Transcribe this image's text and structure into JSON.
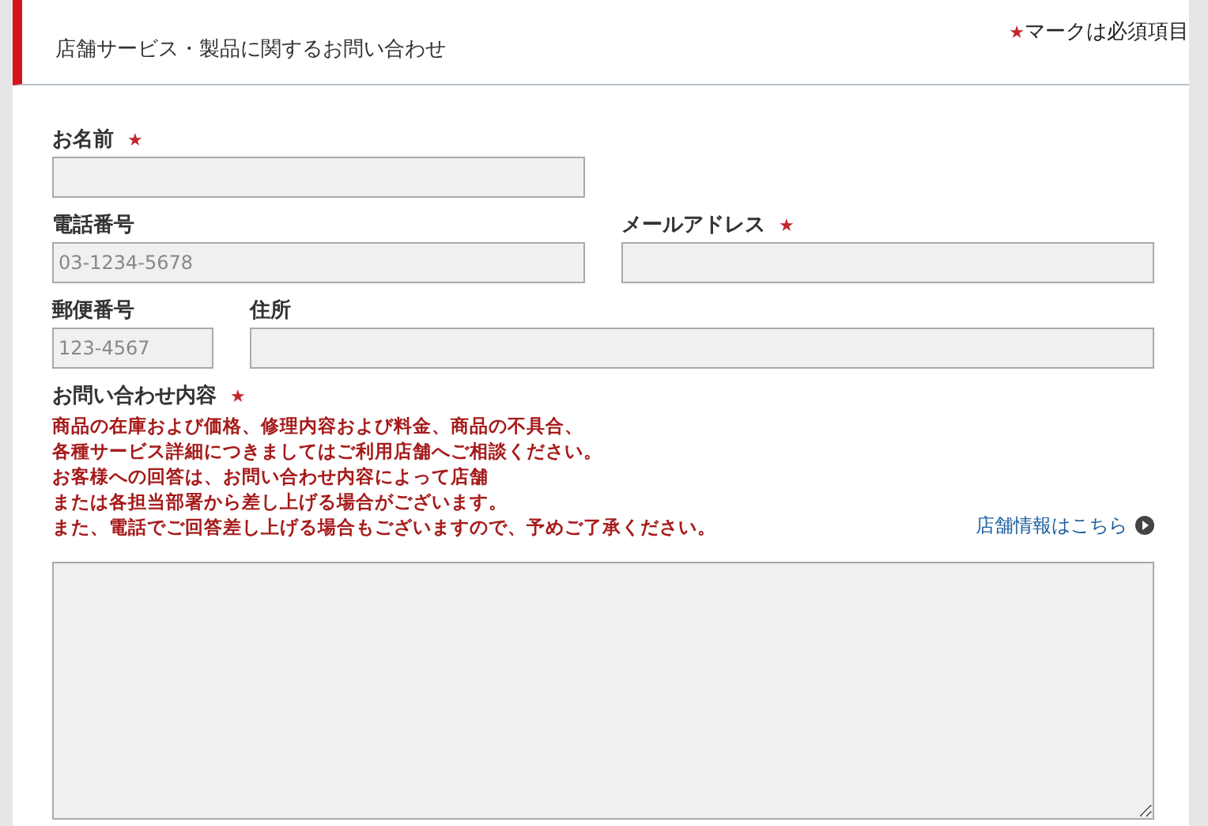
{
  "header": {
    "title": "店舗サービス・製品に関するお問い合わせ",
    "required_note": "マークは必須項目"
  },
  "required_mark": "★",
  "rows": [
    [
      {
        "label": "お名前",
        "required": true
      }
    ],
    [
      {
        "label": "電話番号",
        "required": false,
        "placeholder": "03-1234-5678"
      },
      {
        "label": "メールアドレス",
        "required": true
      }
    ],
    [
      {
        "label": "郵便番号",
        "required": false,
        "placeholder": "123-4567"
      },
      {
        "label": "住所",
        "required": false
      }
    ]
  ],
  "inquiry": {
    "label": "お問い合わせ内容",
    "required": true,
    "notes": [
      "商品の在庫および価格、修理内容および料金、商品の不具合、",
      "各種サービス詳細につきましてはご利用店舗へご相談ください。",
      "お客様への回答は、お問い合わせ内容によって店舗",
      "または各担当部署から差し上げる場合がございます。",
      "また、電話でご回答差し上げる場合もございますので、予めご了承ください。"
    ],
    "link": "店舗情報はこちら"
  }
}
